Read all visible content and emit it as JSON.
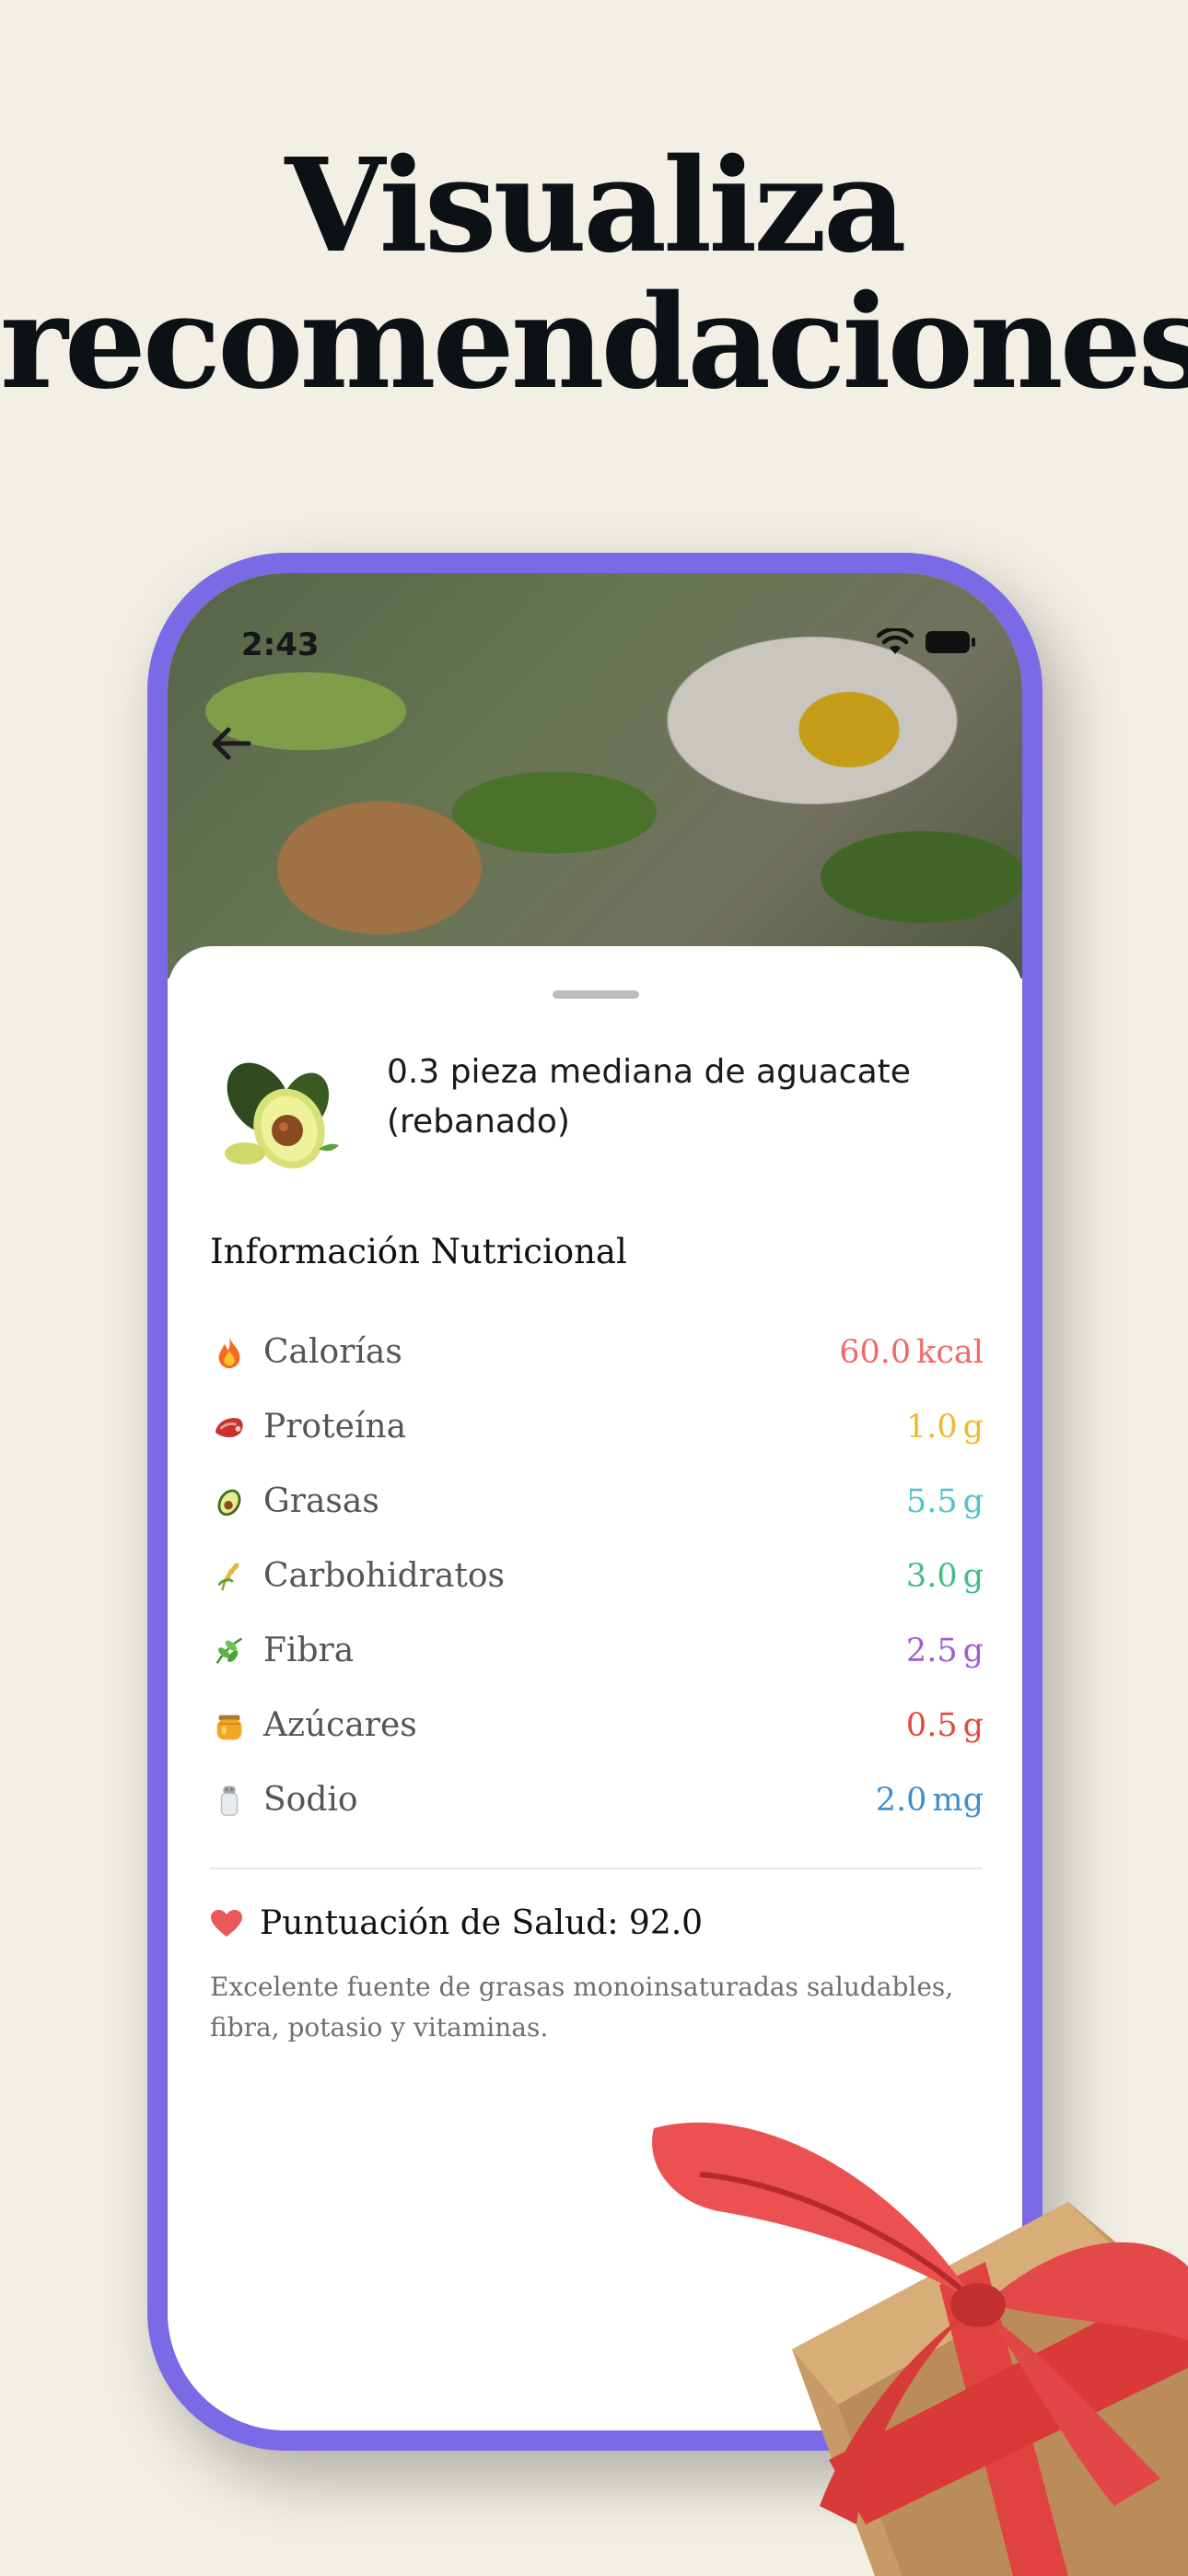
{
  "headline": {
    "line1": "Visualiza",
    "line2": "recomendaciones"
  },
  "status_bar": {
    "time": "2:43"
  },
  "icons": {
    "back": "arrow-left-icon",
    "wifi": "wifi-icon",
    "battery": "battery-icon",
    "heart": "heart-icon",
    "gift": "gift-box-icon"
  },
  "food": {
    "title": "0.3 pieza mediana de aguacate (rebanado)",
    "image": "avocado-icon"
  },
  "nutrition": {
    "title": "Información Nutricional",
    "items": [
      {
        "icon": "fire-icon",
        "label": "Calorías",
        "value": "60.0",
        "unit": "kcal",
        "color": "#f06a6a"
      },
      {
        "icon": "meat-icon",
        "label": "Proteína",
        "value": "1.0",
        "unit": "g",
        "color": "#f2b82e"
      },
      {
        "icon": "avocado-icon",
        "label": "Grasas",
        "value": "5.5",
        "unit": "g",
        "color": "#4fc4c9"
      },
      {
        "icon": "wheat-icon",
        "label": "Carbohidratos",
        "value": "3.0",
        "unit": "g",
        "color": "#3fbf86"
      },
      {
        "icon": "leaf-icon",
        "label": "Fibra",
        "value": "2.5",
        "unit": "g",
        "color": "#a35bd0"
      },
      {
        "icon": "honey-icon",
        "label": "Azúcares",
        "value": "0.5",
        "unit": "g",
        "color": "#e64a3b"
      },
      {
        "icon": "salt-icon",
        "label": "Sodio",
        "value": "2.0",
        "unit": "mg",
        "color": "#3b8fd1"
      }
    ]
  },
  "health": {
    "score_text": "Puntuación de Salud: 92.0",
    "description": "Excelente fuente de grasas monoinsaturadas saludables, fibra, potasio y vitaminas."
  },
  "colors": {
    "background": "#f2efe4",
    "phone_frame": "#7b6ae6",
    "heart": "#e85a5a"
  }
}
